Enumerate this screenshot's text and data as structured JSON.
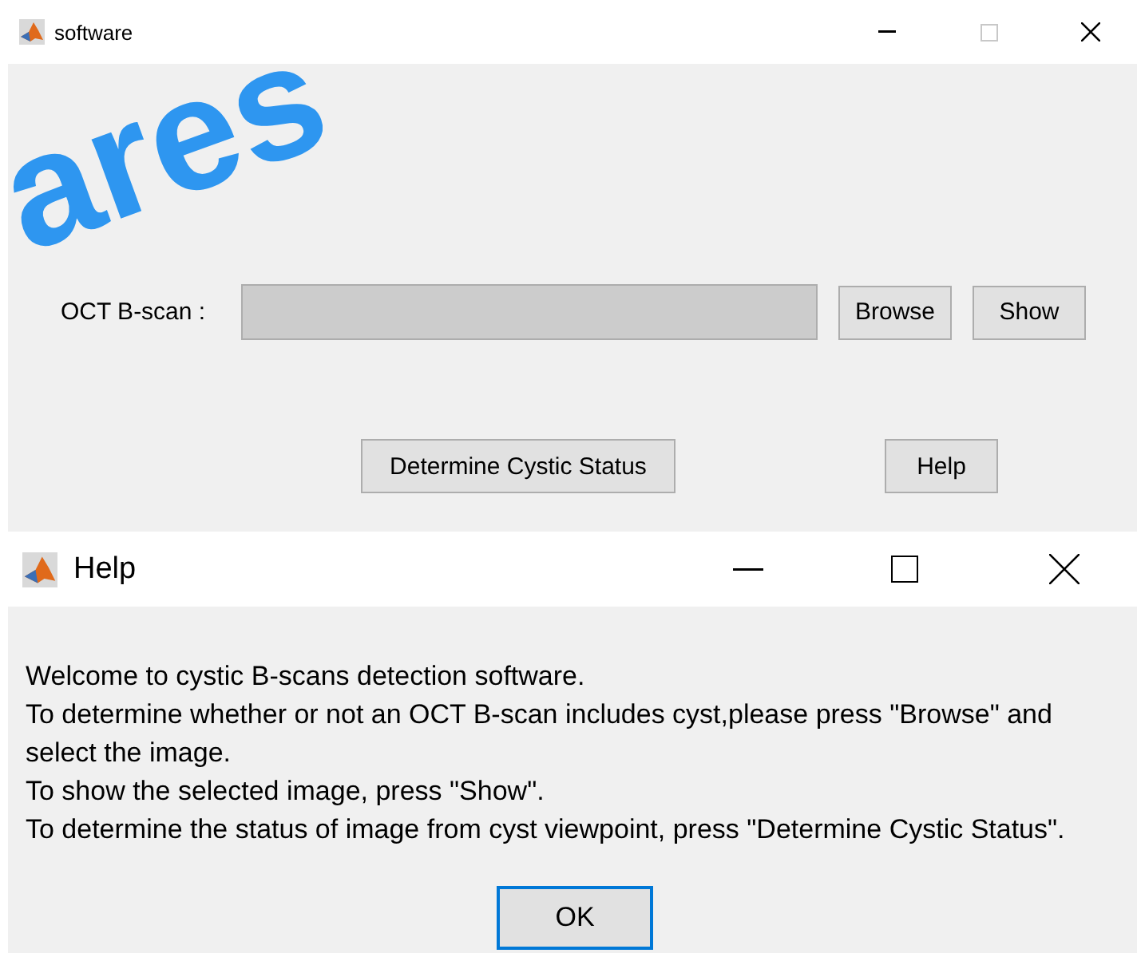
{
  "overlay_text": "ares",
  "main_window": {
    "title": "software",
    "maximize_disabled": true,
    "field_label": "OCT B-scan :",
    "file_buttons": [
      "Browse",
      "Show"
    ],
    "action_buttons": [
      "Determine Cystic Status",
      "Help"
    ]
  },
  "help_dialog": {
    "title": "Help",
    "lines": [
      "Welcome to cystic B-scans detection software.",
      "To determine whether or not an OCT B-scan includes cyst,please press \"Browse\" and select the image.",
      "To show the selected image, press \"Show\".",
      "To determine the status of image from cyst viewpoint, press \"Determine Cystic Status\"."
    ],
    "ok_button": "OK"
  }
}
